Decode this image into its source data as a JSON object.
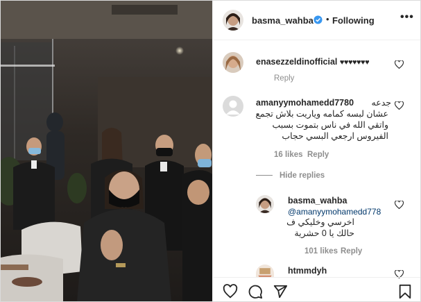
{
  "post": {
    "author": "basma_wahba",
    "header_separator": "•",
    "follow_status": "Following",
    "more": "•••"
  },
  "comments": [
    {
      "user": "enasezzeldinofficial",
      "text": "♥♥♥♥♥♥♥",
      "reply": "Reply"
    },
    {
      "user": "amanyymohamedd7780",
      "text_line1": "جدعه",
      "text_rest": "عشان لبسه كمامه وياريت بلاش تجمع واتقي الله في ناس بتموت بسبب الفيروس ارجعي البسي حجاب",
      "likes": "16 likes",
      "reply": "Reply",
      "hide_replies": "Hide replies"
    },
    {
      "user": "basma_wahba",
      "mention": "@amanyymohamedd778",
      "text": "اخرسي وخليكي ف حالك يا 0 حشرية",
      "likes": "101 likes",
      "reply": "Reply"
    },
    {
      "user": "htmmdyh"
    }
  ],
  "footer": {
    "icons": [
      "heart-icon",
      "comment-icon",
      "share-icon",
      "bookmark-icon"
    ]
  },
  "colors": {
    "link_blue": "#00376b",
    "verified_blue": "#3897f0",
    "muted": "#8e8e8e"
  }
}
